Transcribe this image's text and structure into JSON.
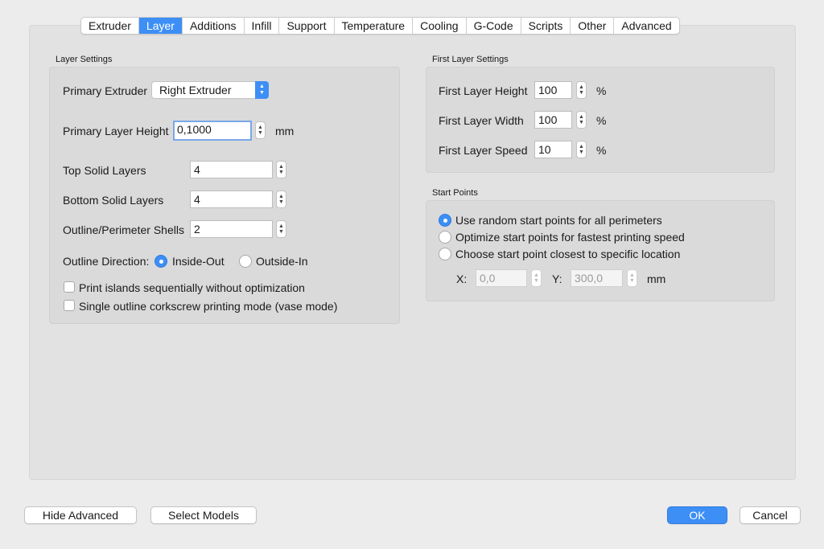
{
  "tabs": [
    "Extruder",
    "Layer",
    "Additions",
    "Infill",
    "Support",
    "Temperature",
    "Cooling",
    "G-Code",
    "Scripts",
    "Other",
    "Advanced"
  ],
  "active_tab": "Layer",
  "layer_settings": {
    "title": "Layer Settings",
    "primary_extruder_label": "Primary Extruder",
    "primary_extruder_value": "Right Extruder",
    "primary_layer_height_label": "Primary Layer Height",
    "primary_layer_height_value": "0,1000",
    "primary_layer_height_unit": "mm",
    "top_solid_layers_label": "Top Solid Layers",
    "top_solid_layers_value": "4",
    "bottom_solid_layers_label": "Bottom Solid Layers",
    "bottom_solid_layers_value": "4",
    "outline_shells_label": "Outline/Perimeter Shells",
    "outline_shells_value": "2",
    "outline_direction_label": "Outline Direction:",
    "outline_direction_options": [
      "Inside-Out",
      "Outside-In"
    ],
    "outline_direction_selected": "Inside-Out",
    "print_islands_label": "Print islands sequentially without optimization",
    "print_islands_checked": false,
    "vase_mode_label": "Single outline corkscrew printing mode (vase mode)",
    "vase_mode_checked": false
  },
  "first_layer_settings": {
    "title": "First Layer Settings",
    "height_label": "First Layer Height",
    "height_value": "100",
    "width_label": "First Layer Width",
    "width_value": "100",
    "speed_label": "First Layer Speed",
    "speed_value": "10",
    "unit": "%"
  },
  "start_points": {
    "title": "Start Points",
    "options": [
      "Use random start points for all perimeters",
      "Optimize start points for fastest printing speed",
      "Choose start point closest to specific location"
    ],
    "selected": "Use random start points for all perimeters",
    "x_label": "X:",
    "x_value": "0,0",
    "y_label": "Y:",
    "y_value": "300,0",
    "unit": "mm"
  },
  "footer": {
    "hide_advanced": "Hide Advanced",
    "select_models": "Select Models",
    "ok": "OK",
    "cancel": "Cancel"
  },
  "colors": {
    "accent": "#3d8ff5",
    "window_bg": "#ececec",
    "panel_bg": "#e2e2e2",
    "group_bg": "#dadada"
  }
}
